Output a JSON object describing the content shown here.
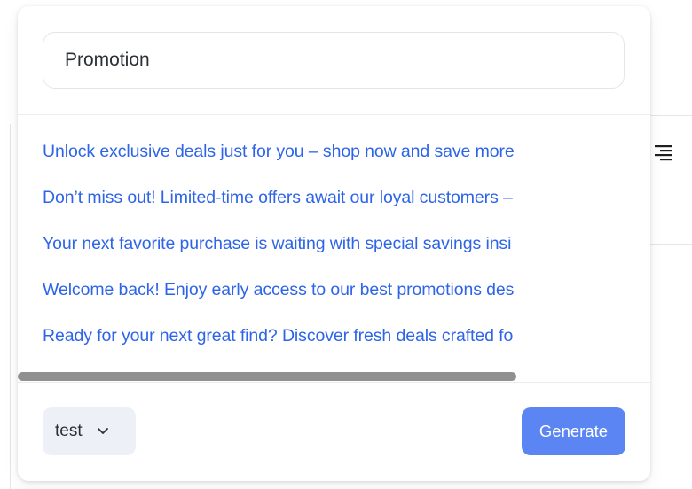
{
  "prompt": {
    "value": "Promotion"
  },
  "suggestions": [
    "Unlock exclusive deals just for you – shop now and save more",
    "Don’t miss out! Limited-time offers await our loyal customers –",
    "Your next favorite purchase is waiting with special savings insi",
    "Welcome back! Enjoy early access to our best promotions des",
    "Ready for your next great find? Discover fresh deals crafted fo"
  ],
  "footer": {
    "model_selected": "test",
    "generate_label": "Generate"
  },
  "icons": {
    "chevron": "chevron-down-icon",
    "align": "align-right-icon"
  },
  "colors": {
    "link": "#2d64e8",
    "primary_button": "#5b85f2",
    "select_bg": "#edf1f7"
  }
}
